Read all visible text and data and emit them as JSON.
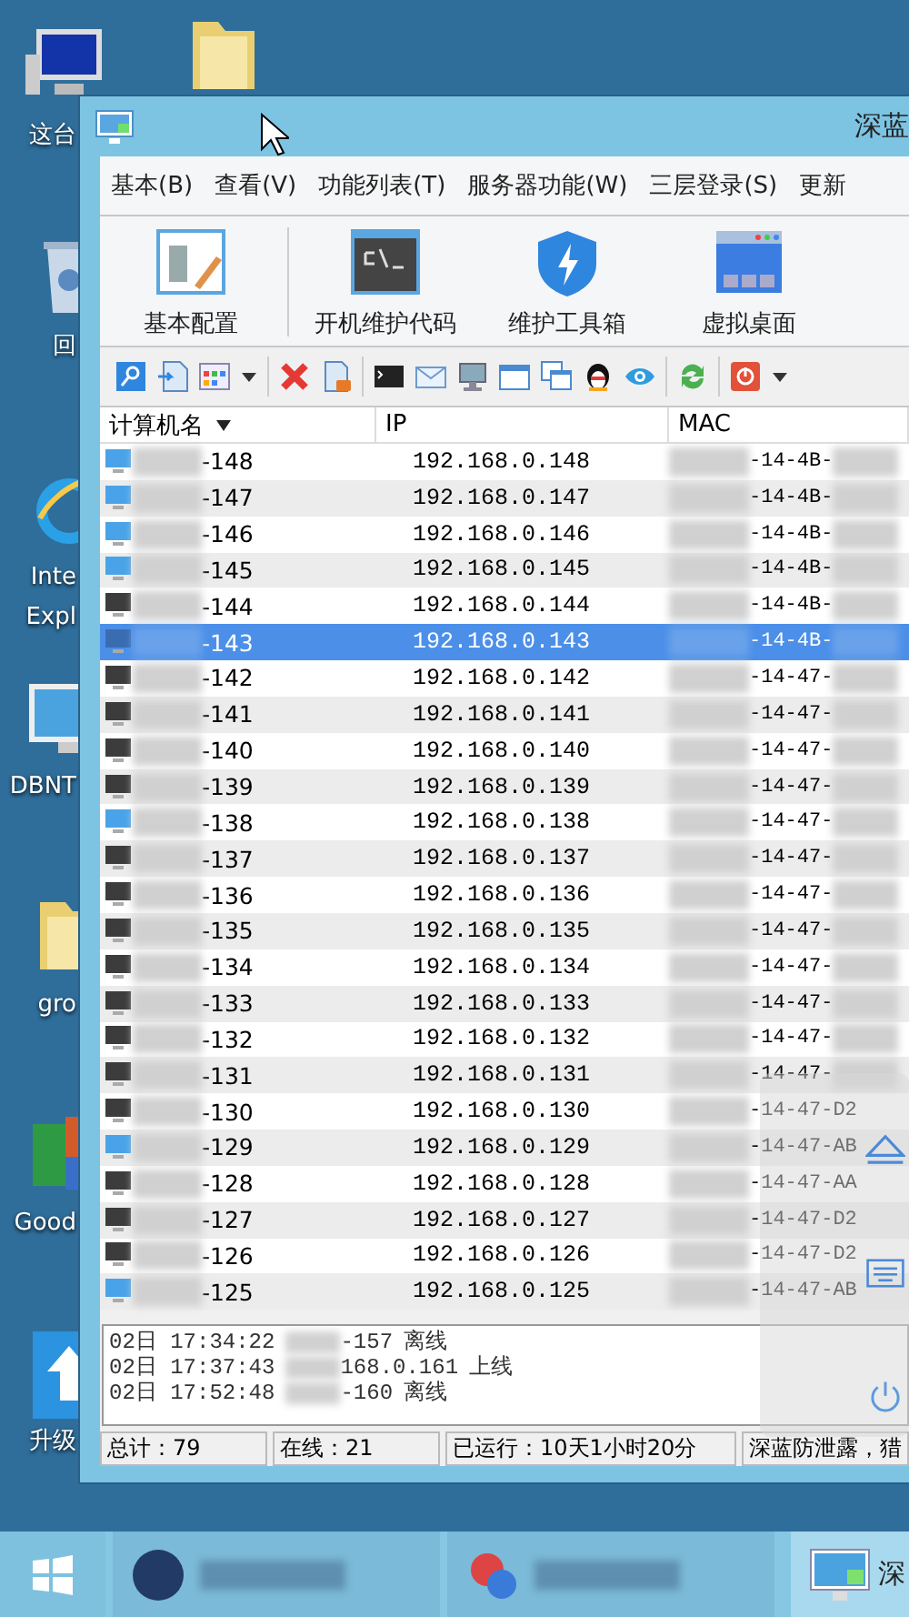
{
  "desktop": {
    "icons": [
      {
        "kind": "computer",
        "lines": [
          "这台"
        ]
      },
      {
        "kind": "folder"
      },
      {
        "kind": "recycle",
        "lines": [
          "回"
        ]
      },
      {
        "kind": "browser",
        "lines": [
          "Inte",
          "Expl"
        ]
      },
      {
        "kind": "monitor",
        "lines": [
          "DBNT"
        ]
      },
      {
        "kind": "folder",
        "lines": [
          "gro"
        ]
      },
      {
        "kind": "office",
        "lines": [
          "Good"
        ]
      },
      {
        "kind": "upgrade",
        "lines": [
          "升级"
        ]
      }
    ]
  },
  "window": {
    "title": "深蓝"
  },
  "menu": [
    "基本(B)",
    "查看(V)",
    "功能列表(T)",
    "服务器功能(W)",
    "三层登录(S)",
    "更新"
  ],
  "toolbar": [
    {
      "kind": "config",
      "label": "基本配置"
    },
    {
      "kind": "console",
      "label": "开机维护代码"
    },
    {
      "kind": "shield",
      "label": "维护工具箱"
    },
    {
      "kind": "desktop",
      "label": "虚拟桌面"
    }
  ],
  "table": {
    "columns": [
      {
        "label": "计算机名",
        "sorted": true
      },
      {
        "label": "IP",
        "sorted": false
      },
      {
        "label": "MAC",
        "sorted": false
      }
    ],
    "rows": [
      {
        "name": "-148",
        "ip": "192.168.0.148",
        "mac": "-14-4B-",
        "online": true,
        "selected": false
      },
      {
        "name": "-147",
        "ip": "192.168.0.147",
        "mac": "-14-4B-",
        "online": true,
        "selected": false
      },
      {
        "name": "-146",
        "ip": "192.168.0.146",
        "mac": "-14-4B-",
        "online": true,
        "selected": false
      },
      {
        "name": "-145",
        "ip": "192.168.0.145",
        "mac": "-14-4B-",
        "online": true,
        "selected": false
      },
      {
        "name": "-144",
        "ip": "192.168.0.144",
        "mac": "-14-4B-",
        "online": false,
        "selected": false
      },
      {
        "name": "-143",
        "ip": "192.168.0.143",
        "mac": "-14-4B-",
        "online": false,
        "selected": true
      },
      {
        "name": "-142",
        "ip": "192.168.0.142",
        "mac": "-14-47-",
        "online": false,
        "selected": false
      },
      {
        "name": "-141",
        "ip": "192.168.0.141",
        "mac": "-14-47-",
        "online": false,
        "selected": false
      },
      {
        "name": "-140",
        "ip": "192.168.0.140",
        "mac": "-14-47-",
        "online": false,
        "selected": false
      },
      {
        "name": "-139",
        "ip": "192.168.0.139",
        "mac": "-14-47-",
        "online": false,
        "selected": false
      },
      {
        "name": "-138",
        "ip": "192.168.0.138",
        "mac": "-14-47-",
        "online": true,
        "selected": false
      },
      {
        "name": "-137",
        "ip": "192.168.0.137",
        "mac": "-14-47-",
        "online": false,
        "selected": false
      },
      {
        "name": "-136",
        "ip": "192.168.0.136",
        "mac": "-14-47-",
        "online": false,
        "selected": false
      },
      {
        "name": "-135",
        "ip": "192.168.0.135",
        "mac": "-14-47-",
        "online": false,
        "selected": false
      },
      {
        "name": "-134",
        "ip": "192.168.0.134",
        "mac": "-14-47-",
        "online": false,
        "selected": false
      },
      {
        "name": "-133",
        "ip": "192.168.0.133",
        "mac": "-14-47-",
        "online": false,
        "selected": false
      },
      {
        "name": "-132",
        "ip": "192.168.0.132",
        "mac": "-14-47-",
        "online": false,
        "selected": false
      },
      {
        "name": "-131",
        "ip": "192.168.0.131",
        "mac": "-14-47-",
        "online": false,
        "selected": false
      },
      {
        "name": "-130",
        "ip": "192.168.0.130",
        "mac": "-14-47-D2",
        "online": false,
        "selected": false
      },
      {
        "name": "-129",
        "ip": "192.168.0.129",
        "mac": "-14-47-AB",
        "online": true,
        "selected": false
      },
      {
        "name": "-128",
        "ip": "192.168.0.128",
        "mac": "-14-47-AA",
        "online": false,
        "selected": false
      },
      {
        "name": "-127",
        "ip": "192.168.0.127",
        "mac": "-14-47-D2",
        "online": false,
        "selected": false
      },
      {
        "name": "-126",
        "ip": "192.168.0.126",
        "mac": "-14-47-D2",
        "online": false,
        "selected": false
      },
      {
        "name": "-125",
        "ip": "192.168.0.125",
        "mac": "-14-47-AB",
        "online": true,
        "selected": false
      }
    ]
  },
  "log": [
    {
      "time": "02日 17:34:22",
      "subject": "-157",
      "event": "离线"
    },
    {
      "time": "02日 17:37:43",
      "subject": "168.0.161",
      "event": "上线"
    },
    {
      "time": "02日 17:52:48",
      "subject": "-160",
      "event": "离线"
    }
  ],
  "status_bar": [
    "总计：79",
    "在线：21",
    "已运行：10天1小时20分",
    "深蓝防泄露，猎"
  ],
  "taskbar": {
    "active_label": "深"
  }
}
